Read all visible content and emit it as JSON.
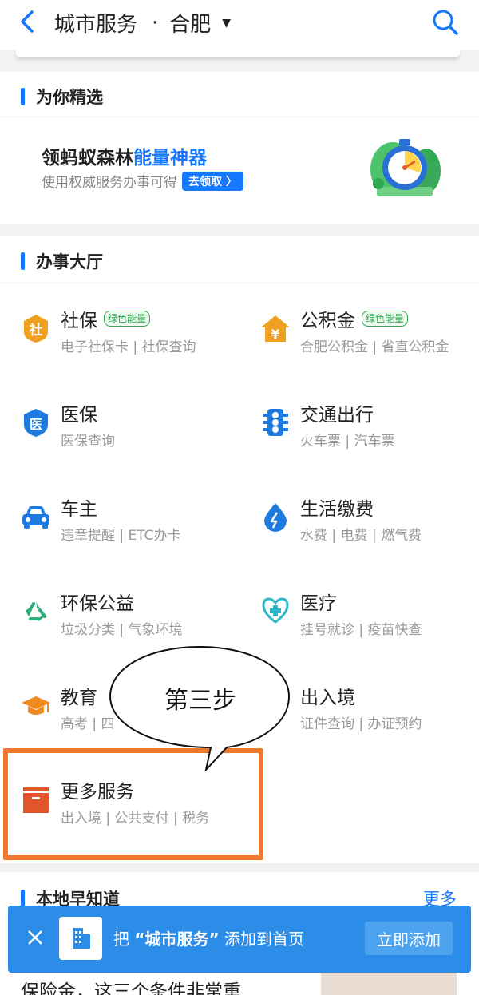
{
  "header": {
    "title": "城市服务",
    "separator": "·",
    "city": "合肥",
    "caret": "▼"
  },
  "picks": {
    "section_title": "为你精选",
    "promo_title_main": "领蚂蚁森林",
    "promo_title_highlight": "能量神器",
    "promo_subtitle": "使用权威服务办事可得",
    "promo_button": "去领取 〉"
  },
  "hall": {
    "section_title": "办事大厅",
    "services": [
      {
        "name": "社保",
        "badge": "绿色能量",
        "sub": "电子社保卡 | 社保查询",
        "icon": "shebao-icon"
      },
      {
        "name": "公积金",
        "badge": "绿色能量",
        "sub": "合肥公积金 | 省直公积金",
        "icon": "gongjijin-icon"
      },
      {
        "name": "医保",
        "badge": "",
        "sub": "医保查询",
        "icon": "yibao-icon"
      },
      {
        "name": "交通出行",
        "badge": "",
        "sub": "火车票 | 汽车票",
        "icon": "traffic-light-icon"
      },
      {
        "name": "车主",
        "badge": "",
        "sub": "违章提醒 | ETC办卡",
        "icon": "car-icon"
      },
      {
        "name": "生活缴费",
        "badge": "",
        "sub": "水费 | 电费 | 燃气费",
        "icon": "water-drop-icon"
      },
      {
        "name": "环保公益",
        "badge": "",
        "sub": "垃圾分类 | 气象环境",
        "icon": "recycle-icon"
      },
      {
        "name": "医疗",
        "badge": "",
        "sub": "挂号就诊 | 疫苗快查",
        "icon": "stethoscope-icon"
      },
      {
        "name": "教育",
        "badge": "",
        "sub": "高考 | 四",
        "icon": "graduation-cap-icon"
      },
      {
        "name": "出入境",
        "badge": "",
        "sub": "证件查询 | 办证预约",
        "icon": "passport-icon"
      },
      {
        "name": "更多服务",
        "badge": "",
        "sub": "出入境 | 公共支付 | 税务",
        "icon": "box-icon"
      }
    ],
    "shebao_glyph": "社",
    "gongjijin_glyph": "¥",
    "yibao_glyph": "医"
  },
  "callout": {
    "text": "第三步"
  },
  "local": {
    "section_title": "本地早知道",
    "more_link": "更多",
    "article_title": "保险金，这三个条件非常重"
  },
  "toast": {
    "text_prefix": "把",
    "text_bold": "“城市服务”",
    "text_suffix": "添加到首页",
    "button": "立即添加"
  },
  "colors": {
    "accent": "#1677ff",
    "highlight": "#f0782a",
    "toast_bg": "#2b8de8",
    "badge_green": "#2fa84f"
  }
}
